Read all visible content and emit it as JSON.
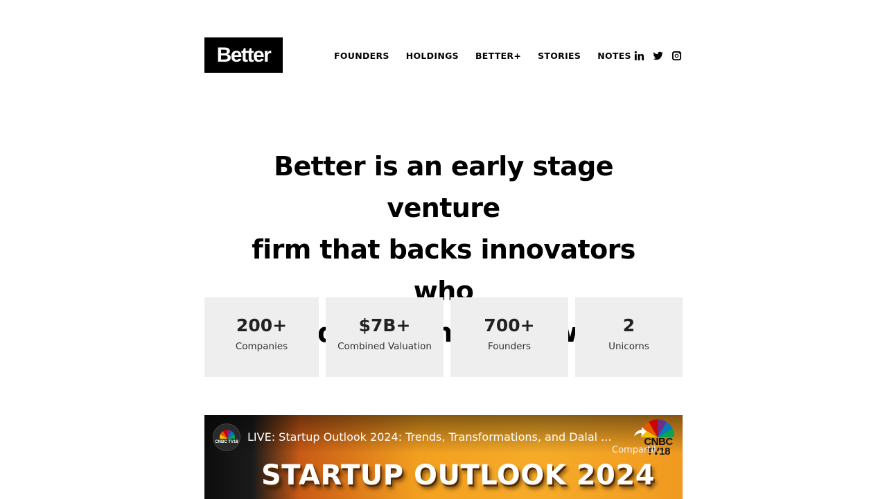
{
  "header": {
    "logo_text": "Better",
    "nav": [
      {
        "label": "FOUNDERS"
      },
      {
        "label": "HOLDINGS"
      },
      {
        "label": "BETTER+"
      },
      {
        "label": "STORIES"
      },
      {
        "label": "NOTES"
      }
    ],
    "social_icons": [
      "linkedin-icon",
      "twitter-icon",
      "instagram-icon"
    ]
  },
  "hero": {
    "line1": "Better is an early stage venture",
    "line2": "firm that backs innovators who",
    "line3": "intend to change the world."
  },
  "stats": [
    {
      "value": "200+",
      "label": "Companies"
    },
    {
      "value": "$7B+",
      "label": "Combined Valuation"
    },
    {
      "value": "700+",
      "label": "Founders"
    },
    {
      "value": "2",
      "label": "Unicorns"
    }
  ],
  "video": {
    "title": "LIVE: Startup Outlook 2024: Trends, Transformations, and Dalal ...",
    "share_label": "Compartil...",
    "channel_logo_text": "CNBC TV18",
    "corner_logo_text": "CNBC TV18",
    "banner_text": "STARTUP OUTLOOK 2024"
  },
  "colors": {
    "stat_background": "#eeeeee",
    "logo_background": "#000000",
    "video_orange": "#f3a01f"
  }
}
